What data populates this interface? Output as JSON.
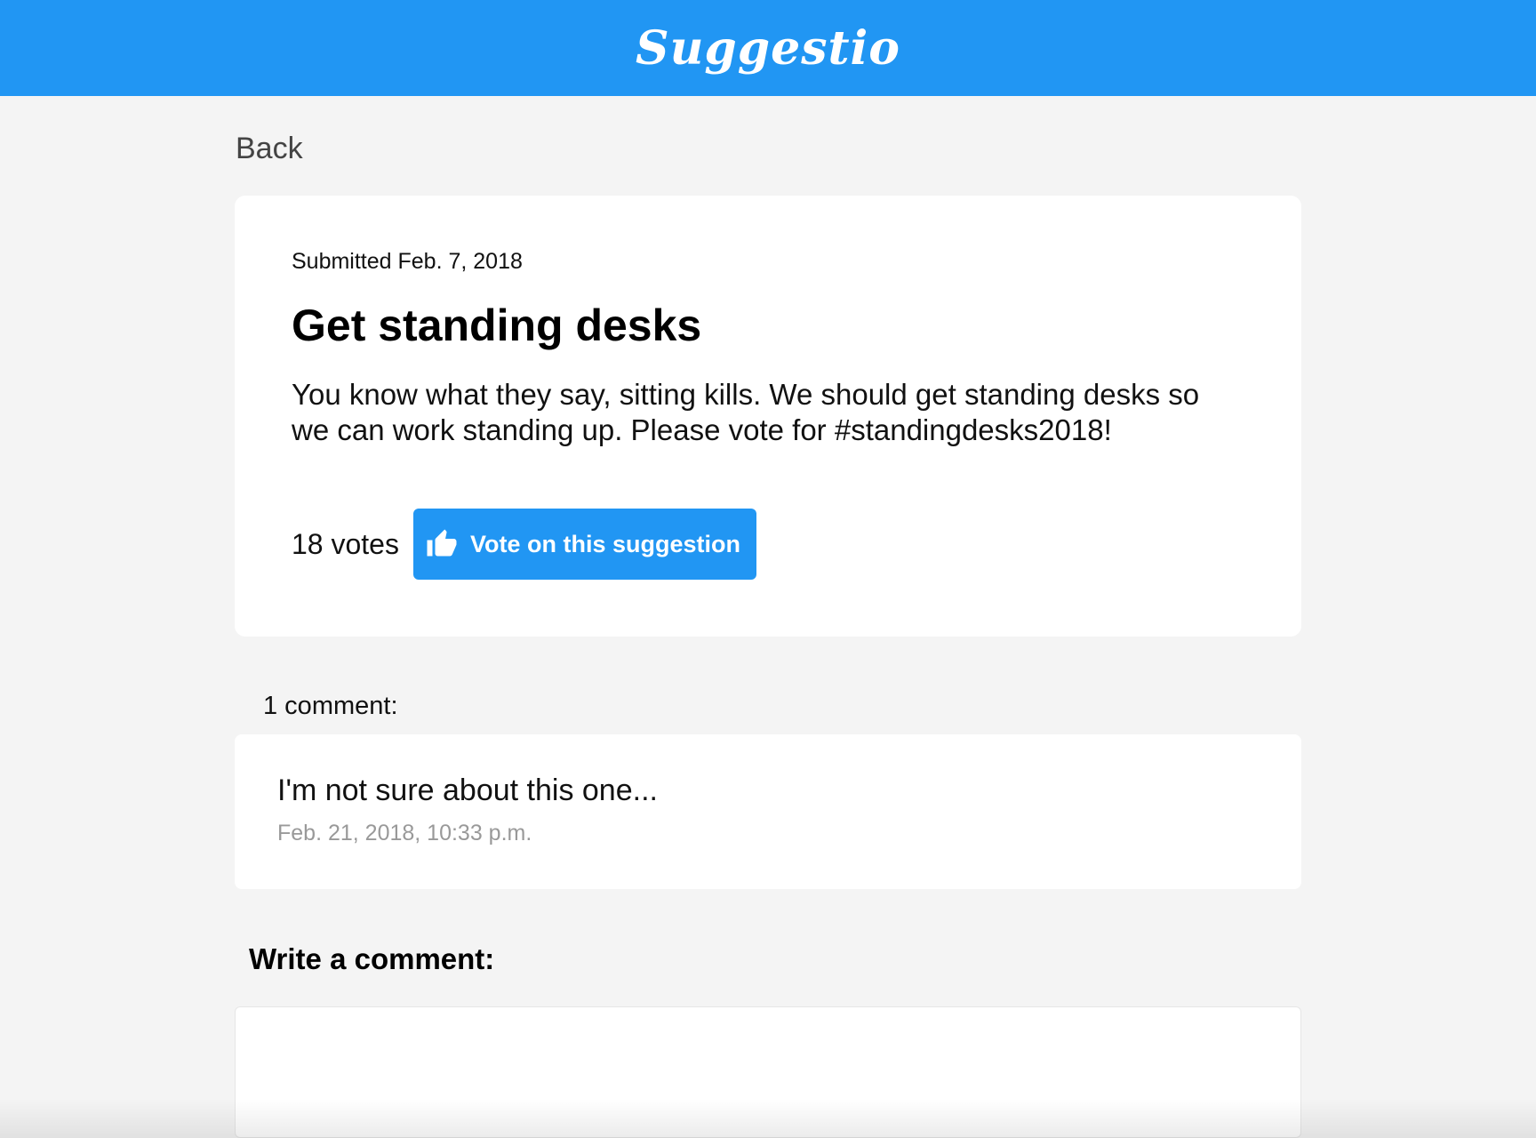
{
  "header": {
    "logo_text": "Suggestio",
    "background_color": "#2196f3"
  },
  "nav": {
    "back_label": "Back"
  },
  "suggestion": {
    "submitted": "Submitted Feb. 7, 2018",
    "title": "Get standing desks",
    "body": "You know what they say, sitting kills. We should get standing desks so we can work standing up. Please vote for #standingdesks2018!",
    "vote_count": "18 votes",
    "vote_button_label": "Vote on this suggestion",
    "vote_button_icon": "thumbs-up-icon"
  },
  "comments": {
    "heading": "1 comment:",
    "items": [
      {
        "text": "I'm not sure about this one...",
        "date": "Feb. 21, 2018, 10:33 p.m."
      }
    ]
  },
  "write_comment": {
    "heading": "Write a comment:",
    "value": "",
    "placeholder": ""
  }
}
